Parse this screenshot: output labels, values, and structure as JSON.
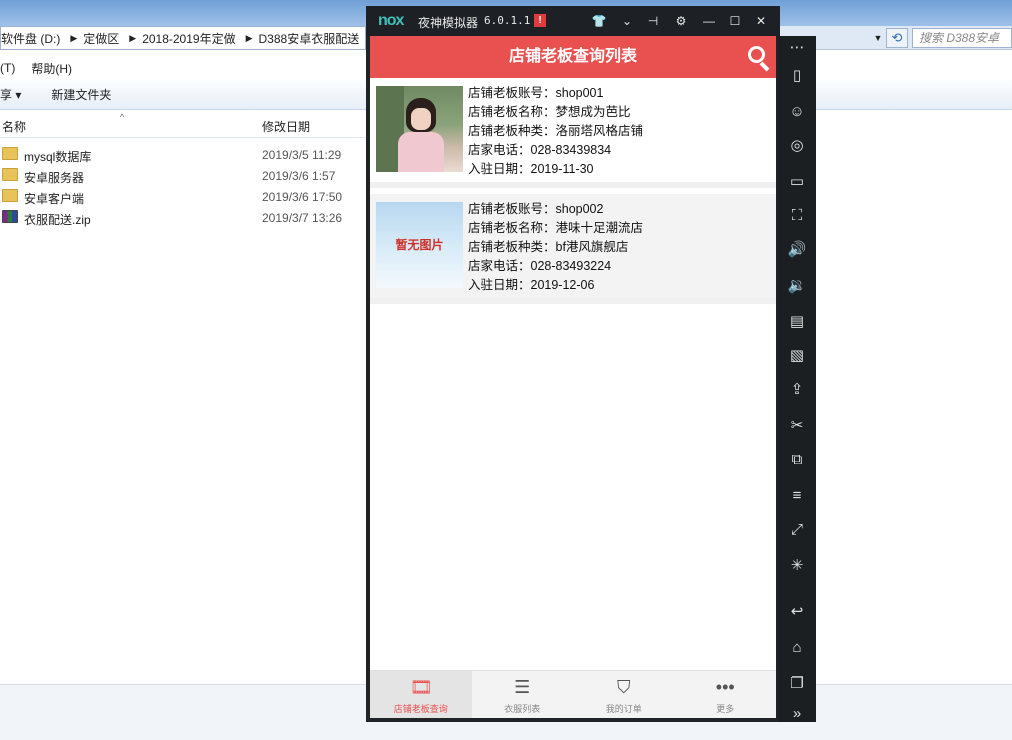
{
  "explorer": {
    "breadcrumb": [
      "软件盘 (D:)",
      "定做区",
      "2018-2019年定做",
      "D388安卓衣服配送"
    ],
    "search_placeholder": "搜索 D388安卓",
    "menu": [
      "(T)",
      "帮助(H)"
    ],
    "toolbar": [
      "享 ▾",
      "新建文件夹"
    ],
    "columns": {
      "name": "名称",
      "date": "修改日期"
    },
    "files": [
      {
        "name": "mysql数据库",
        "date": "2019/3/5 11:29",
        "type": "folder"
      },
      {
        "name": "安卓服务器",
        "date": "2019/3/6 1:57",
        "type": "folder"
      },
      {
        "name": "安卓客户端",
        "date": "2019/3/6 17:50",
        "type": "folder"
      },
      {
        "name": "衣服配送.zip",
        "date": "2019/3/7 13:26",
        "type": "zip"
      }
    ]
  },
  "nox": {
    "logo": "nox",
    "name": "夜神模拟器",
    "version": "6.0.1.1",
    "warn": "!"
  },
  "app": {
    "title": "店铺老板查询列表",
    "accent": "#e8514f",
    "shops": [
      {
        "account": "店铺老板账号：shop001",
        "name": "店铺老板名称：梦想成为芭比",
        "type": "店铺老板种类：洛丽塔风格店铺",
        "phone": "店家电话：028-83439834",
        "date": "入驻日期：2019-11-30",
        "image": "photo"
      },
      {
        "account": "店铺老板账号：shop002",
        "name": "店铺老板名称：港味十足潮流店",
        "type": "店铺老板种类：bf港风旗舰店",
        "phone": "店家电话：028-83493224",
        "date": "入驻日期：2019-12-06",
        "image": "暂无图片"
      }
    ],
    "nav": [
      {
        "label": "店铺老板查询",
        "icon": "film-icon",
        "active": true
      },
      {
        "label": "衣服列表",
        "icon": "stack-icon",
        "active": false
      },
      {
        "label": "我的订单",
        "icon": "bookmark-icon",
        "active": false
      },
      {
        "label": "更多",
        "icon": "more-icon",
        "active": false
      }
    ]
  }
}
